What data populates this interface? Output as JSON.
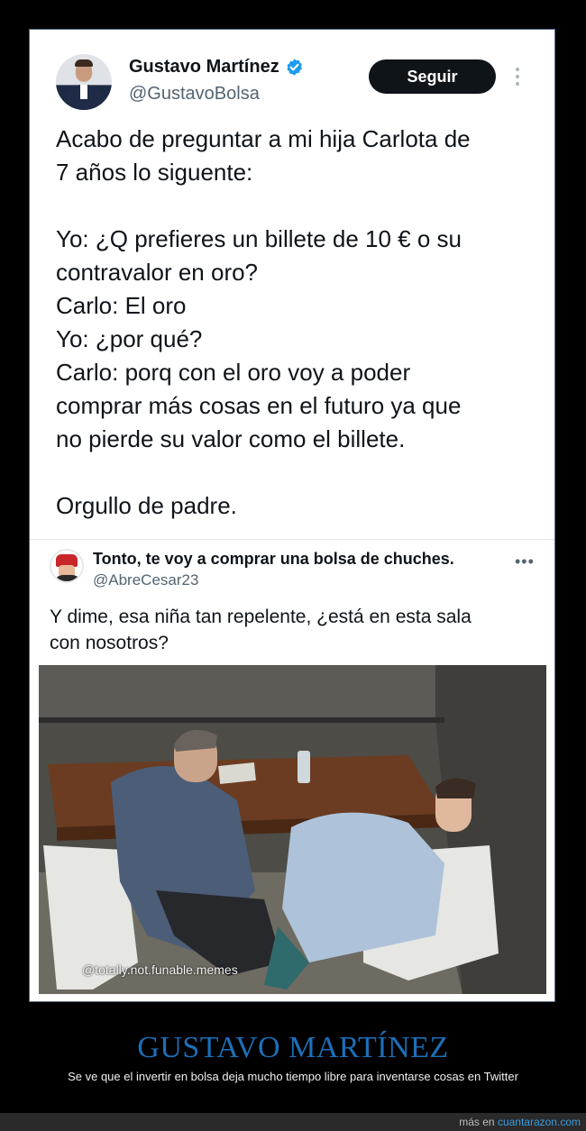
{
  "tweet": {
    "author_name": "Gustavo Martínez",
    "author_handle": "@GustavoBolsa",
    "follow_label": "Seguir",
    "lines": [
      "Acabo de preguntar a mi hija Carlota de",
      "7 años lo siguente:",
      "",
      "Yo: ¿Q prefieres un billete de 10 € o su",
      "contravalor en oro?",
      "Carlo: El oro",
      "Yo: ¿por qué?",
      "Carlo: porq con el oro voy a poder",
      "comprar más cosas en el futuro ya que",
      "no pierde su valor como el billete.",
      "",
      "Orgullo de padre."
    ]
  },
  "reply": {
    "author_name": "Tonto, te voy a comprar una bolsa de chuches.",
    "author_handle": "@AbreCesar23",
    "more_label": "•••",
    "line1": "Y dime, esa niña tan repelente, ¿está en esta sala",
    "line2": "con nosotros?",
    "image_watermark": "@totally.not.funable.memes"
  },
  "caption": {
    "title": "GUSTAVO MARTÍNEZ",
    "subtitle": "Se ve que el invertir en bolsa deja mucho tiempo libre para inventarse cosas en Twitter"
  },
  "footer": {
    "prefix": "más en",
    "site": "cuantarazon.com"
  },
  "colors": {
    "verified": "#1d9bf0",
    "caption_title": "#1d6fb8",
    "link": "#3a9bdc"
  },
  "icons": [
    "verified-badge-icon",
    "more-vertical-icon",
    "more-horizontal-icon"
  ]
}
